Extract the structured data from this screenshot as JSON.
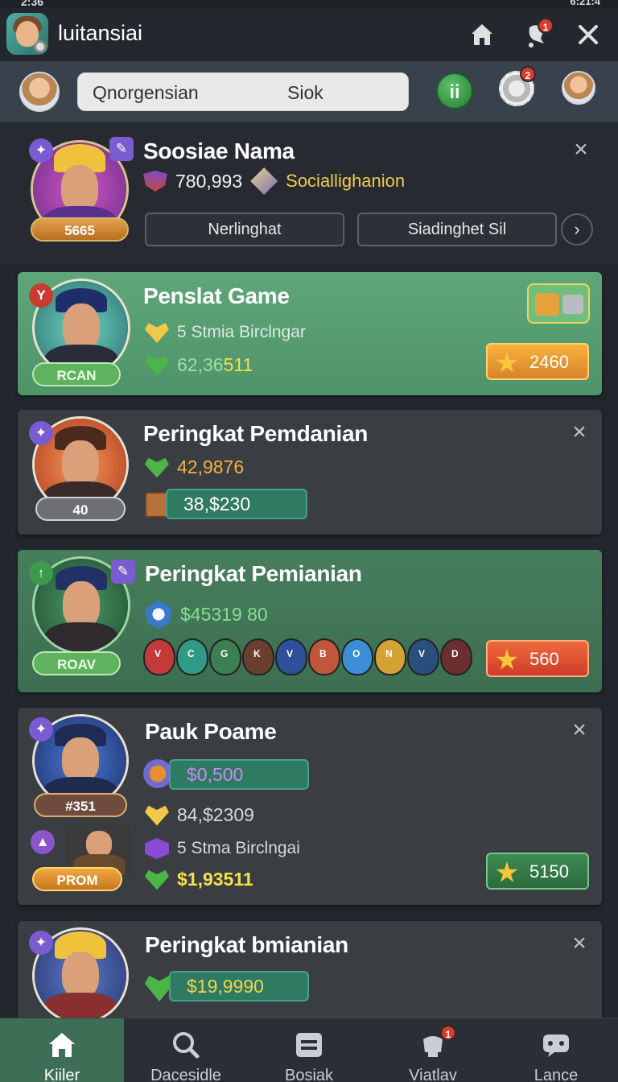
{
  "status": {
    "time": "2:36",
    "right": "6:21:4"
  },
  "app": {
    "title": "luitansiai",
    "notification_count": "1"
  },
  "search": {
    "left_text": "Qnorgensian",
    "right_text": "Siok",
    "green_button": "ii",
    "gear_badge": "2"
  },
  "profile": {
    "name": "Soosiae Nama",
    "score": "780,993",
    "rank_label": "Sociallighanion",
    "level": "5665",
    "buttons": [
      "Nerlinghat",
      "Siadinghet Sil"
    ]
  },
  "cards": [
    {
      "title": "Penslat Game",
      "line1": "5 Stmia Birclngar",
      "value": "62,36",
      "value_highlight": "511",
      "pill": "RCAN",
      "reward": "2460"
    },
    {
      "title": "Peringkat Pemdanian",
      "value1": "42,9876",
      "value2": "38,$230",
      "pill": "40"
    },
    {
      "title": "Peringkat Pemianian",
      "value": "$45319 80",
      "pill": "ROAV",
      "reward": "560",
      "heroes": [
        "V",
        "C",
        "G",
        "K",
        "V",
        "B",
        "O",
        "N",
        "V",
        "D"
      ]
    },
    {
      "title": "Pauk Poame",
      "value1": "$0,500",
      "pill1": "#351",
      "value2": "84,$2309",
      "line3": "5 Stma Birclngai",
      "value4": "$1,93511",
      "pill2": "PROM",
      "reward": "5150"
    },
    {
      "title": "Peringkat bmianian",
      "value": "$19,9990"
    }
  ],
  "nav": {
    "items": [
      {
        "label": "Kiiler"
      },
      {
        "label": "Dacesidle"
      },
      {
        "label": "Bosiak"
      },
      {
        "label": "Viatlav",
        "badge": "1"
      },
      {
        "label": "Lance"
      }
    ]
  }
}
